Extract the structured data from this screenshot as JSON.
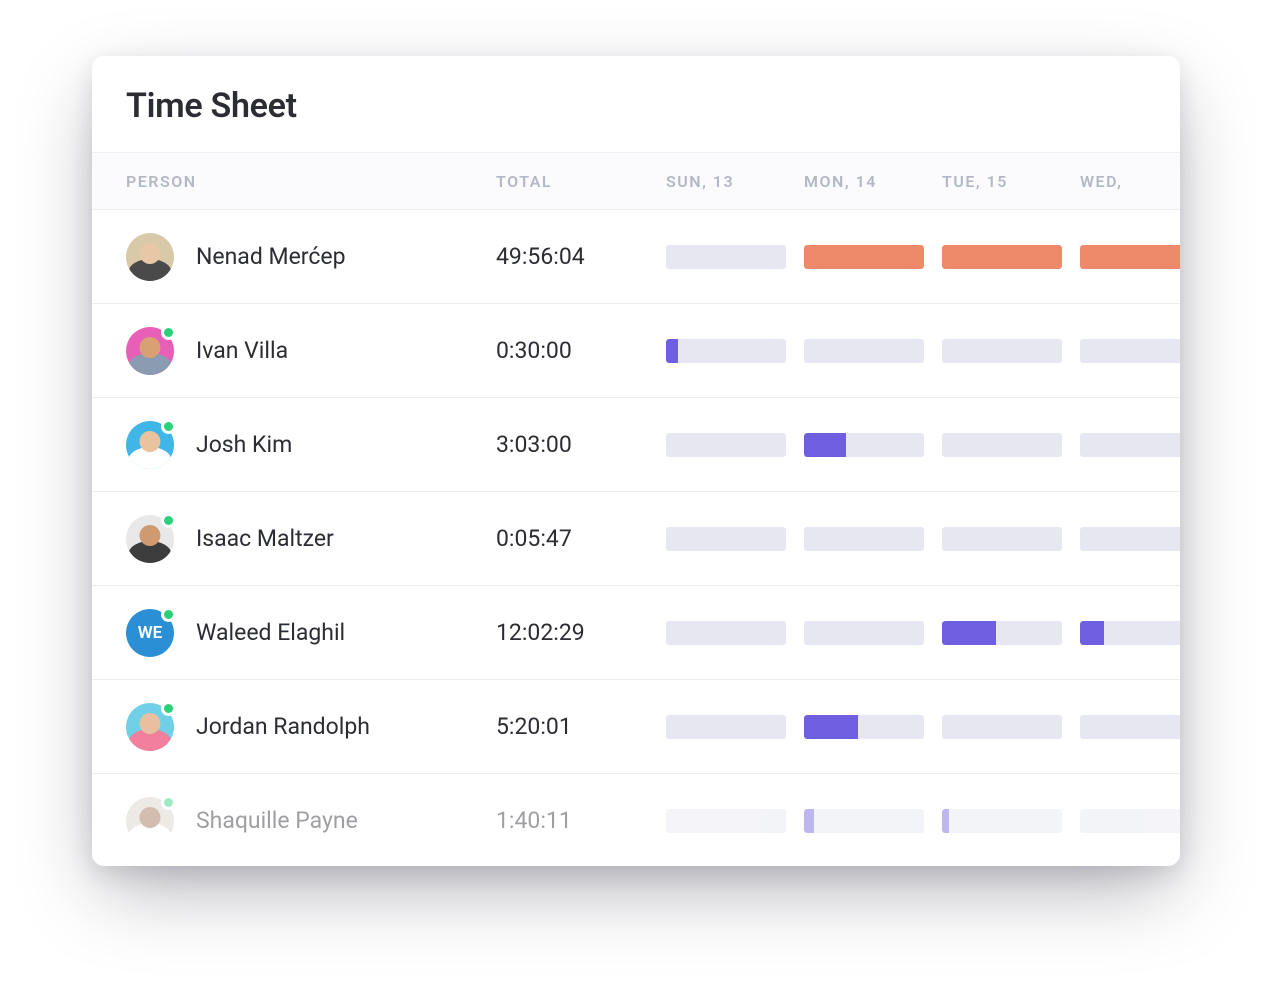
{
  "title": "Time Sheet",
  "columns": {
    "person": "PERSON",
    "total": "TOTAL",
    "days": [
      "SUN, 13",
      "MON, 14",
      "TUE, 15",
      "WED,"
    ]
  },
  "colors": {
    "orange": "#ee8a69",
    "purple": "#6f5fe0",
    "empty": "#e6e7f1"
  },
  "rows": [
    {
      "name": "Nenad Merćep",
      "total": "49:56:04",
      "online": false,
      "avatar": {
        "type": "face",
        "bg": "#d8c9a8",
        "skin": "#e8c7a6",
        "shirt": "#4a4a4a"
      },
      "bars": [
        {
          "pct": 0,
          "color": null
        },
        {
          "pct": 100,
          "color": "orange"
        },
        {
          "pct": 100,
          "color": "orange"
        },
        {
          "pct": 100,
          "color": "orange"
        }
      ]
    },
    {
      "name": "Ivan Villa",
      "total": "0:30:00",
      "online": true,
      "avatar": {
        "type": "face",
        "bg": "#e85fb8",
        "skin": "#d9a074",
        "shirt": "#8a9bb2"
      },
      "bars": [
        {
          "pct": 10,
          "color": "purple"
        },
        {
          "pct": 0,
          "color": null
        },
        {
          "pct": 0,
          "color": null
        },
        {
          "pct": 0,
          "color": null
        }
      ]
    },
    {
      "name": "Josh Kim",
      "total": "3:03:00",
      "online": true,
      "avatar": {
        "type": "face",
        "bg": "#3fb5e8",
        "skin": "#e8c39e",
        "shirt": "#ffffff"
      },
      "bars": [
        {
          "pct": 0,
          "color": null
        },
        {
          "pct": 35,
          "color": "purple"
        },
        {
          "pct": 0,
          "color": null
        },
        {
          "pct": 0,
          "color": null
        }
      ]
    },
    {
      "name": "Isaac Maltzer",
      "total": "0:05:47",
      "online": true,
      "avatar": {
        "type": "face",
        "bg": "#e8e8e8",
        "skin": "#cf9a6f",
        "shirt": "#3c3c3c"
      },
      "bars": [
        {
          "pct": 0,
          "color": null
        },
        {
          "pct": 0,
          "color": null
        },
        {
          "pct": 0,
          "color": null
        },
        {
          "pct": 0,
          "color": null
        }
      ]
    },
    {
      "name": "Waleed Elaghil",
      "total": "12:02:29",
      "online": true,
      "avatar": {
        "type": "initials",
        "bg": "#2b8fd6",
        "text": "WE"
      },
      "bars": [
        {
          "pct": 0,
          "color": null
        },
        {
          "pct": 0,
          "color": null
        },
        {
          "pct": 45,
          "color": "purple"
        },
        {
          "pct": 20,
          "color": "purple"
        }
      ]
    },
    {
      "name": "Jordan Randolph",
      "total": "5:20:01",
      "online": true,
      "avatar": {
        "type": "face",
        "bg": "#6fd0e8",
        "skin": "#e8bfa0",
        "shirt": "#f27f9c"
      },
      "bars": [
        {
          "pct": 0,
          "color": null
        },
        {
          "pct": 45,
          "color": "purple"
        },
        {
          "pct": 0,
          "color": null
        },
        {
          "pct": 0,
          "color": null
        }
      ]
    },
    {
      "name": "Shaquille Payne",
      "total": "1:40:11",
      "online": true,
      "faded": true,
      "avatar": {
        "type": "face",
        "bg": "#d8d0c4",
        "skin": "#9c6f4f",
        "shirt": "#ffffff"
      },
      "bars": [
        {
          "pct": 0,
          "color": null
        },
        {
          "pct": 8,
          "color": "purple"
        },
        {
          "pct": 6,
          "color": "purple"
        },
        {
          "pct": 0,
          "color": null
        }
      ]
    }
  ],
  "chart_data": {
    "type": "table",
    "note": "Day cells render miniature horizontal bars. Percent fill of each bar is an estimate from pixels, not a labeled value.",
    "days": [
      "SUN, 13",
      "MON, 14",
      "TUE, 15",
      "WED"
    ],
    "series": [
      {
        "name": "Nenad Merćep",
        "total": "49:56:04",
        "day_fill_pct": [
          0,
          100,
          100,
          100
        ],
        "color": "orange"
      },
      {
        "name": "Ivan Villa",
        "total": "0:30:00",
        "day_fill_pct": [
          10,
          0,
          0,
          0
        ],
        "color": "purple"
      },
      {
        "name": "Josh Kim",
        "total": "3:03:00",
        "day_fill_pct": [
          0,
          35,
          0,
          0
        ],
        "color": "purple"
      },
      {
        "name": "Isaac Maltzer",
        "total": "0:05:47",
        "day_fill_pct": [
          0,
          0,
          0,
          0
        ],
        "color": "purple"
      },
      {
        "name": "Waleed Elaghil",
        "total": "12:02:29",
        "day_fill_pct": [
          0,
          0,
          45,
          20
        ],
        "color": "purple"
      },
      {
        "name": "Jordan Randolph",
        "total": "5:20:01",
        "day_fill_pct": [
          0,
          45,
          0,
          0
        ],
        "color": "purple"
      },
      {
        "name": "Shaquille Payne",
        "total": "1:40:11",
        "day_fill_pct": [
          0,
          8,
          6,
          0
        ],
        "color": "purple"
      }
    ]
  }
}
